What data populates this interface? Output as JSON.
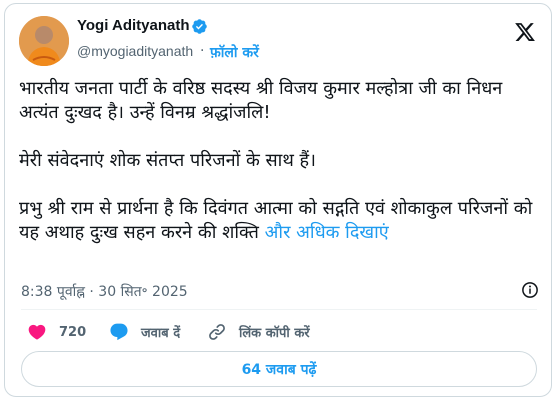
{
  "author": {
    "name": "Yogi Adityanath",
    "handle": "@myogiadityanath",
    "separator": "·",
    "follow_label": "फ़ॉलो करें"
  },
  "tweet": {
    "paragraph1": "भारतीय जनता पार्टी के वरिष्ठ सदस्य श्री विजय कुमार मल्होत्रा जी का निधन अत्यंत दुःखद है। उन्हें विनम्र श्रद्धांजलि!",
    "paragraph2": "मेरी संवेदनाएं शोक संतप्त परिजनों के साथ हैं।",
    "paragraph3": "प्रभु श्री राम से प्रार्थना है कि दिवंगत आत्मा को सद्गति एवं शोकाकुल परिजनों को यह अथाह दुःख सहन करने की शक्ति",
    "show_more": "और अधिक दिखाएं",
    "timestamp": "8:38 पूर्वाह्न · 30 सित॰ 2025"
  },
  "actions": {
    "likes_count": "720",
    "reply_label": "जवाब दें",
    "copy_link_label": "लिंक कॉपी करें",
    "read_replies_label": "64 जवाब पढ़ें"
  },
  "colors": {
    "accent": "#1d9bf0",
    "like": "#f91880",
    "muted": "#536471",
    "text": "#0f1419",
    "border": "#cfd9de"
  },
  "icons": [
    "verified-icon",
    "x-logo-icon",
    "info-icon",
    "heart-icon",
    "reply-bubble-icon",
    "link-icon"
  ]
}
